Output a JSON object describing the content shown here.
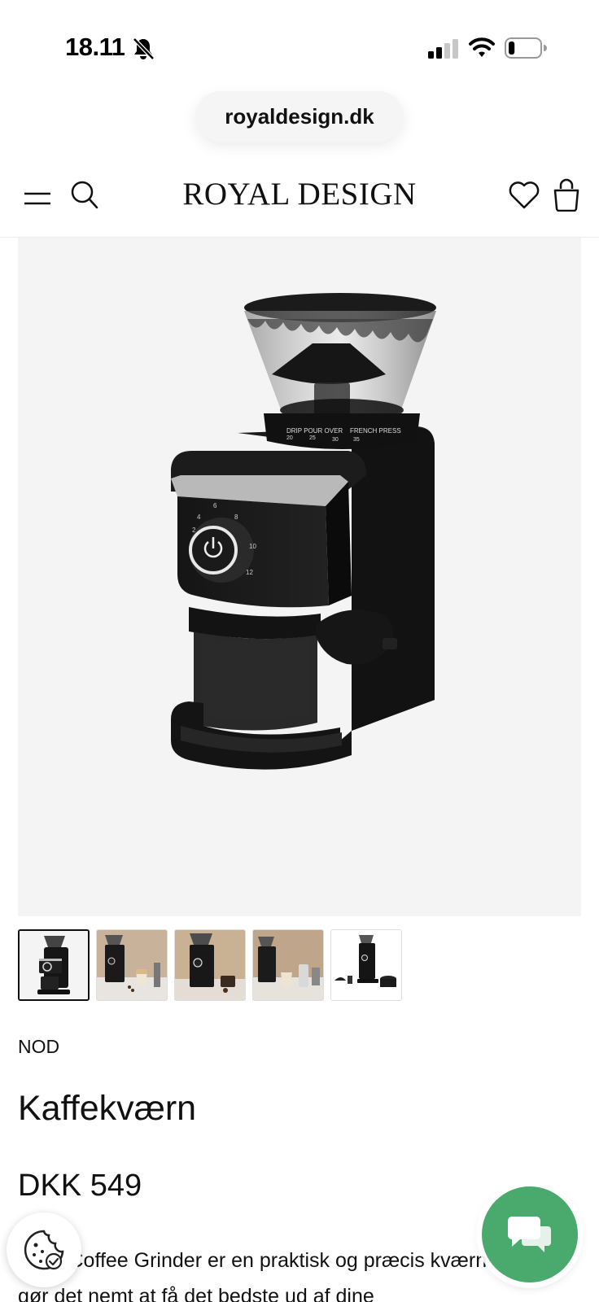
{
  "status_bar": {
    "time": "18.11",
    "icons": [
      "bell-off-icon",
      "cellular-signal-icon",
      "wifi-icon",
      "battery-icon"
    ],
    "battery_level": 0.2
  },
  "browser": {
    "url": "royaldesign.dk"
  },
  "header": {
    "logo": "ROYAL DESIGN",
    "icons": [
      "menu-icon",
      "search-icon",
      "heart-icon",
      "shopping-bag-icon"
    ]
  },
  "gallery": {
    "selected_index": 0,
    "thumbnail_count": 5,
    "dial_text": {
      "drip_pour_over": "DRIP POUR OVER",
      "french_press": "FRENCH PRESS",
      "n20": "20",
      "n25": "25",
      "n30": "30",
      "n35": "35"
    },
    "knob_numbers": [
      "2",
      "4",
      "6",
      "8",
      "10",
      "12"
    ]
  },
  "product": {
    "brand": "NOD",
    "title": "Kaffekværn",
    "price": "DKK 549",
    "description": "NOD Coffee Grinder er en praktisk og præcis kværn der gør det nemt at få det bedste ud af dine"
  },
  "floating": {
    "cookie_icon": "cookie-icon",
    "chat_icon": "chat-bubbles-icon",
    "accent_color": "#4aa96c"
  }
}
